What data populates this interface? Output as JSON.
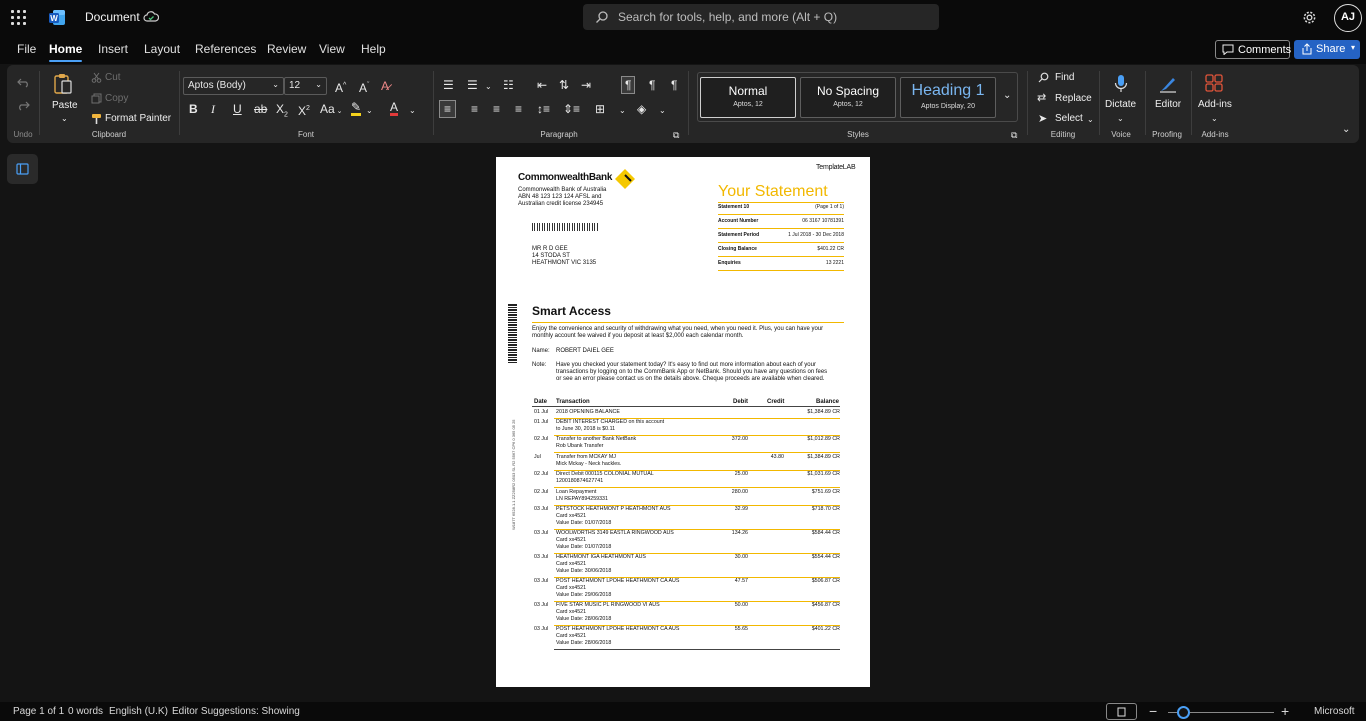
{
  "titlebar": {
    "doc_title": "Document",
    "search_placeholder": "Search for tools, help, and more (Alt + Q)",
    "avatar": "AJ"
  },
  "menu": {
    "tabs": [
      "File",
      "Home",
      "Insert",
      "Layout",
      "References",
      "Review",
      "View",
      "Help"
    ],
    "active": "Home",
    "comments": "Comments",
    "share": "Share"
  },
  "ribbon": {
    "undo_label": "Undo",
    "clipboard": {
      "paste": "Paste",
      "cut": "Cut",
      "copy": "Copy",
      "format_painter": "Format Painter",
      "label": "Clipboard"
    },
    "font": {
      "name": "Aptos (Body)",
      "size": "12",
      "label": "Font"
    },
    "paragraph": {
      "label": "Paragraph"
    },
    "styles": {
      "label": "Styles",
      "items": [
        {
          "name": "Normal",
          "sub": "Aptos, 12"
        },
        {
          "name": "No Spacing",
          "sub": "Aptos, 12"
        },
        {
          "name": "Heading 1",
          "sub": "Aptos Display, 20"
        }
      ]
    },
    "editing": {
      "find": "Find",
      "replace": "Replace",
      "select": "Select",
      "label": "Editing"
    },
    "voice": {
      "dictate": "Dictate",
      "label": "Voice"
    },
    "proofing": {
      "editor": "Editor",
      "label": "Proofing"
    },
    "addins": {
      "btn": "Add-ins",
      "label": "Add-ins"
    }
  },
  "document": {
    "bank_name": "CommonwealthBank",
    "bank_addr": [
      "Commonwealth Bank of Australia",
      "ABN 48 123 123 124 AFSL and",
      "Australian credit license 234945"
    ],
    "templatelab": "TemplateLAB",
    "your_statement": "Your Statement",
    "info": [
      [
        "Statement 10",
        "(Page 1 of 1)"
      ],
      [
        "Account Number",
        "06 3167 10781391"
      ],
      [
        "Statement Period",
        "1 Jul 2018 - 30 Dec 2018"
      ],
      [
        "Closing Balance",
        "$401.22 CR"
      ],
      [
        "Enquiries",
        "13 2221"
      ]
    ],
    "customer_addr": [
      "MR R D GEE",
      "14 STODA ST",
      "HEATHMONT VIC 3135"
    ],
    "product": "Smart Access",
    "intro": [
      "Enjoy the convenience and security of withdrawing what you need, when you need it. Plus, you can have your",
      "monthly account fee waived if you deposit at least $2,000 each calendar month."
    ],
    "name_label": "Name:",
    "name_value": "ROBERT DAIEL GEE",
    "note_label": "Note:",
    "note": [
      "Have you checked your statement today? It's easy to find out more information about each of your",
      "transactions by logging on to the CommBank App or NetBank. Should you have any questions on fees",
      "or see an error please contact us on the details above. Cheque proceeds are available when cleared."
    ],
    "side_code": "W187T 6528.1.1 ZZ258R2 0503 SL R2 5567 CP6 0 365 05 25",
    "headers": {
      "date": "Date",
      "txn": "Transaction",
      "debit": "Debit",
      "credit": "Credit",
      "balance": "Balance"
    },
    "rows": [
      {
        "date": "01 Jul",
        "lines": [
          "2018 OPENING BALANCE"
        ],
        "debit": "",
        "credit": "",
        "balance": "$1,384.89 CR"
      },
      {
        "date": "01 Jul",
        "lines": [
          "DEBIT INTEREST CHARGED on this account",
          "to June 30, 2018 is $0.11"
        ],
        "debit": "",
        "credit": "",
        "balance": ""
      },
      {
        "date": "02 Jul",
        "lines": [
          "Transfer to another Bank NetBank",
          "Rob Ubank Transfer"
        ],
        "debit": "372.00",
        "credit": "",
        "balance": "$1,012.89 CR"
      },
      {
        "date": "Jul",
        "lines": [
          "Transfer from MCKAY MJ",
          "Mick Mckay - Neck hackles."
        ],
        "debit": "",
        "credit": "43.80",
        "balance": "$1,384.89 CR"
      },
      {
        "date": "02 Jul",
        "lines": [
          "Direct Debit 000115 COLONIAL MUTUAL",
          "1200180874627741"
        ],
        "debit": "25.00",
        "credit": "",
        "balance": "$1,031.69 CR"
      },
      {
        "date": "02 Jul",
        "lines": [
          "Loan Repayment",
          "LN REPAY894259331"
        ],
        "debit": "280.00",
        "credit": "",
        "balance": "$751.69 CR"
      },
      {
        "date": "03 Jul",
        "lines": [
          "PETSTOCK HEATHMONT P HEATHMONT AUS",
          "Card xx4521",
          "Value Date: 01/07/2018"
        ],
        "debit": "32.99",
        "credit": "",
        "balance": "$718.70 CR"
      },
      {
        "date": "03 Jul",
        "lines": [
          "WOOLWORTHS 3149 EASTLA RINGWOOD AUS",
          "Card xx4521",
          "Value Date: 01/07/2018"
        ],
        "debit": "134.26",
        "credit": "",
        "balance": "$584.44 CR"
      },
      {
        "date": "03 Jul",
        "lines": [
          "HEATHMONT IGA HEATHMONT AUS",
          "Card xx4521",
          "Value Date: 30/06/2018"
        ],
        "debit": "30.00",
        "credit": "",
        "balance": "$554.44 CR"
      },
      {
        "date": "03 Jul",
        "lines": [
          "POST HEATHMONT LPOHE HEATHMONT CA AUS",
          "Card xx4521",
          "Value Date: 29/06/2018"
        ],
        "debit": "47.57",
        "credit": "",
        "balance": "$506.87 CR"
      },
      {
        "date": "03 Jul",
        "lines": [
          "FIVE STAR MUSIC PL RINGWOOD VI AUS",
          "Card xx4521",
          "Value Date: 28/06/2018"
        ],
        "debit": "50.00",
        "credit": "",
        "balance": "$456.87 CR"
      },
      {
        "date": "03 Jul",
        "lines": [
          "POST HEATHMONT LPOHE HEATHMONT CA AUS",
          "Card xx4521",
          "Value Date: 28/06/2018"
        ],
        "debit": "55.65",
        "credit": "",
        "balance": "$401.22 CR"
      }
    ]
  },
  "status": {
    "page": "Page 1 of 1",
    "words": "0 words",
    "lang": "English (U.K)",
    "editor": "Editor Suggestions: Showing",
    "zoom_label": "Microsoft"
  },
  "colors": {
    "accent": "#2563c4",
    "statement_yellow": "#f2b800"
  }
}
